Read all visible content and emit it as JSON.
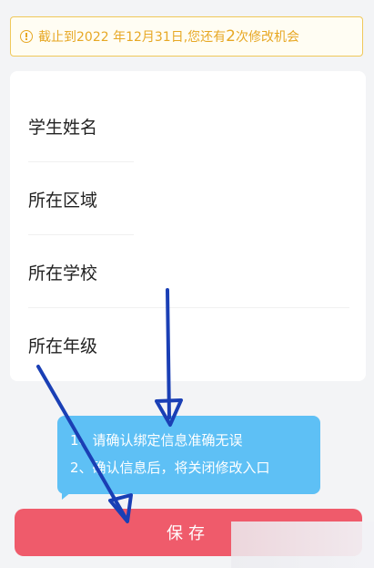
{
  "notice": {
    "text_before": "截止到2022 年12月31日,您还有",
    "count": "2",
    "text_after": "次修改机会",
    "icon": "info-icon"
  },
  "form": {
    "fields": [
      {
        "label": "学生姓名"
      },
      {
        "label": "所在区域"
      },
      {
        "label": "所在学校"
      },
      {
        "label": "所在年级"
      }
    ]
  },
  "tooltip": {
    "line1": "1、请确认绑定信息准确无误",
    "line2": "2、确认信息后，将关闭修改入口"
  },
  "save_button": {
    "label": "保存"
  },
  "colors": {
    "notice": "#e7a825",
    "tooltip_bg": "#5ec0f5",
    "save_button": "#ef5b6b",
    "annotation_arrow": "#1a3fb5"
  }
}
